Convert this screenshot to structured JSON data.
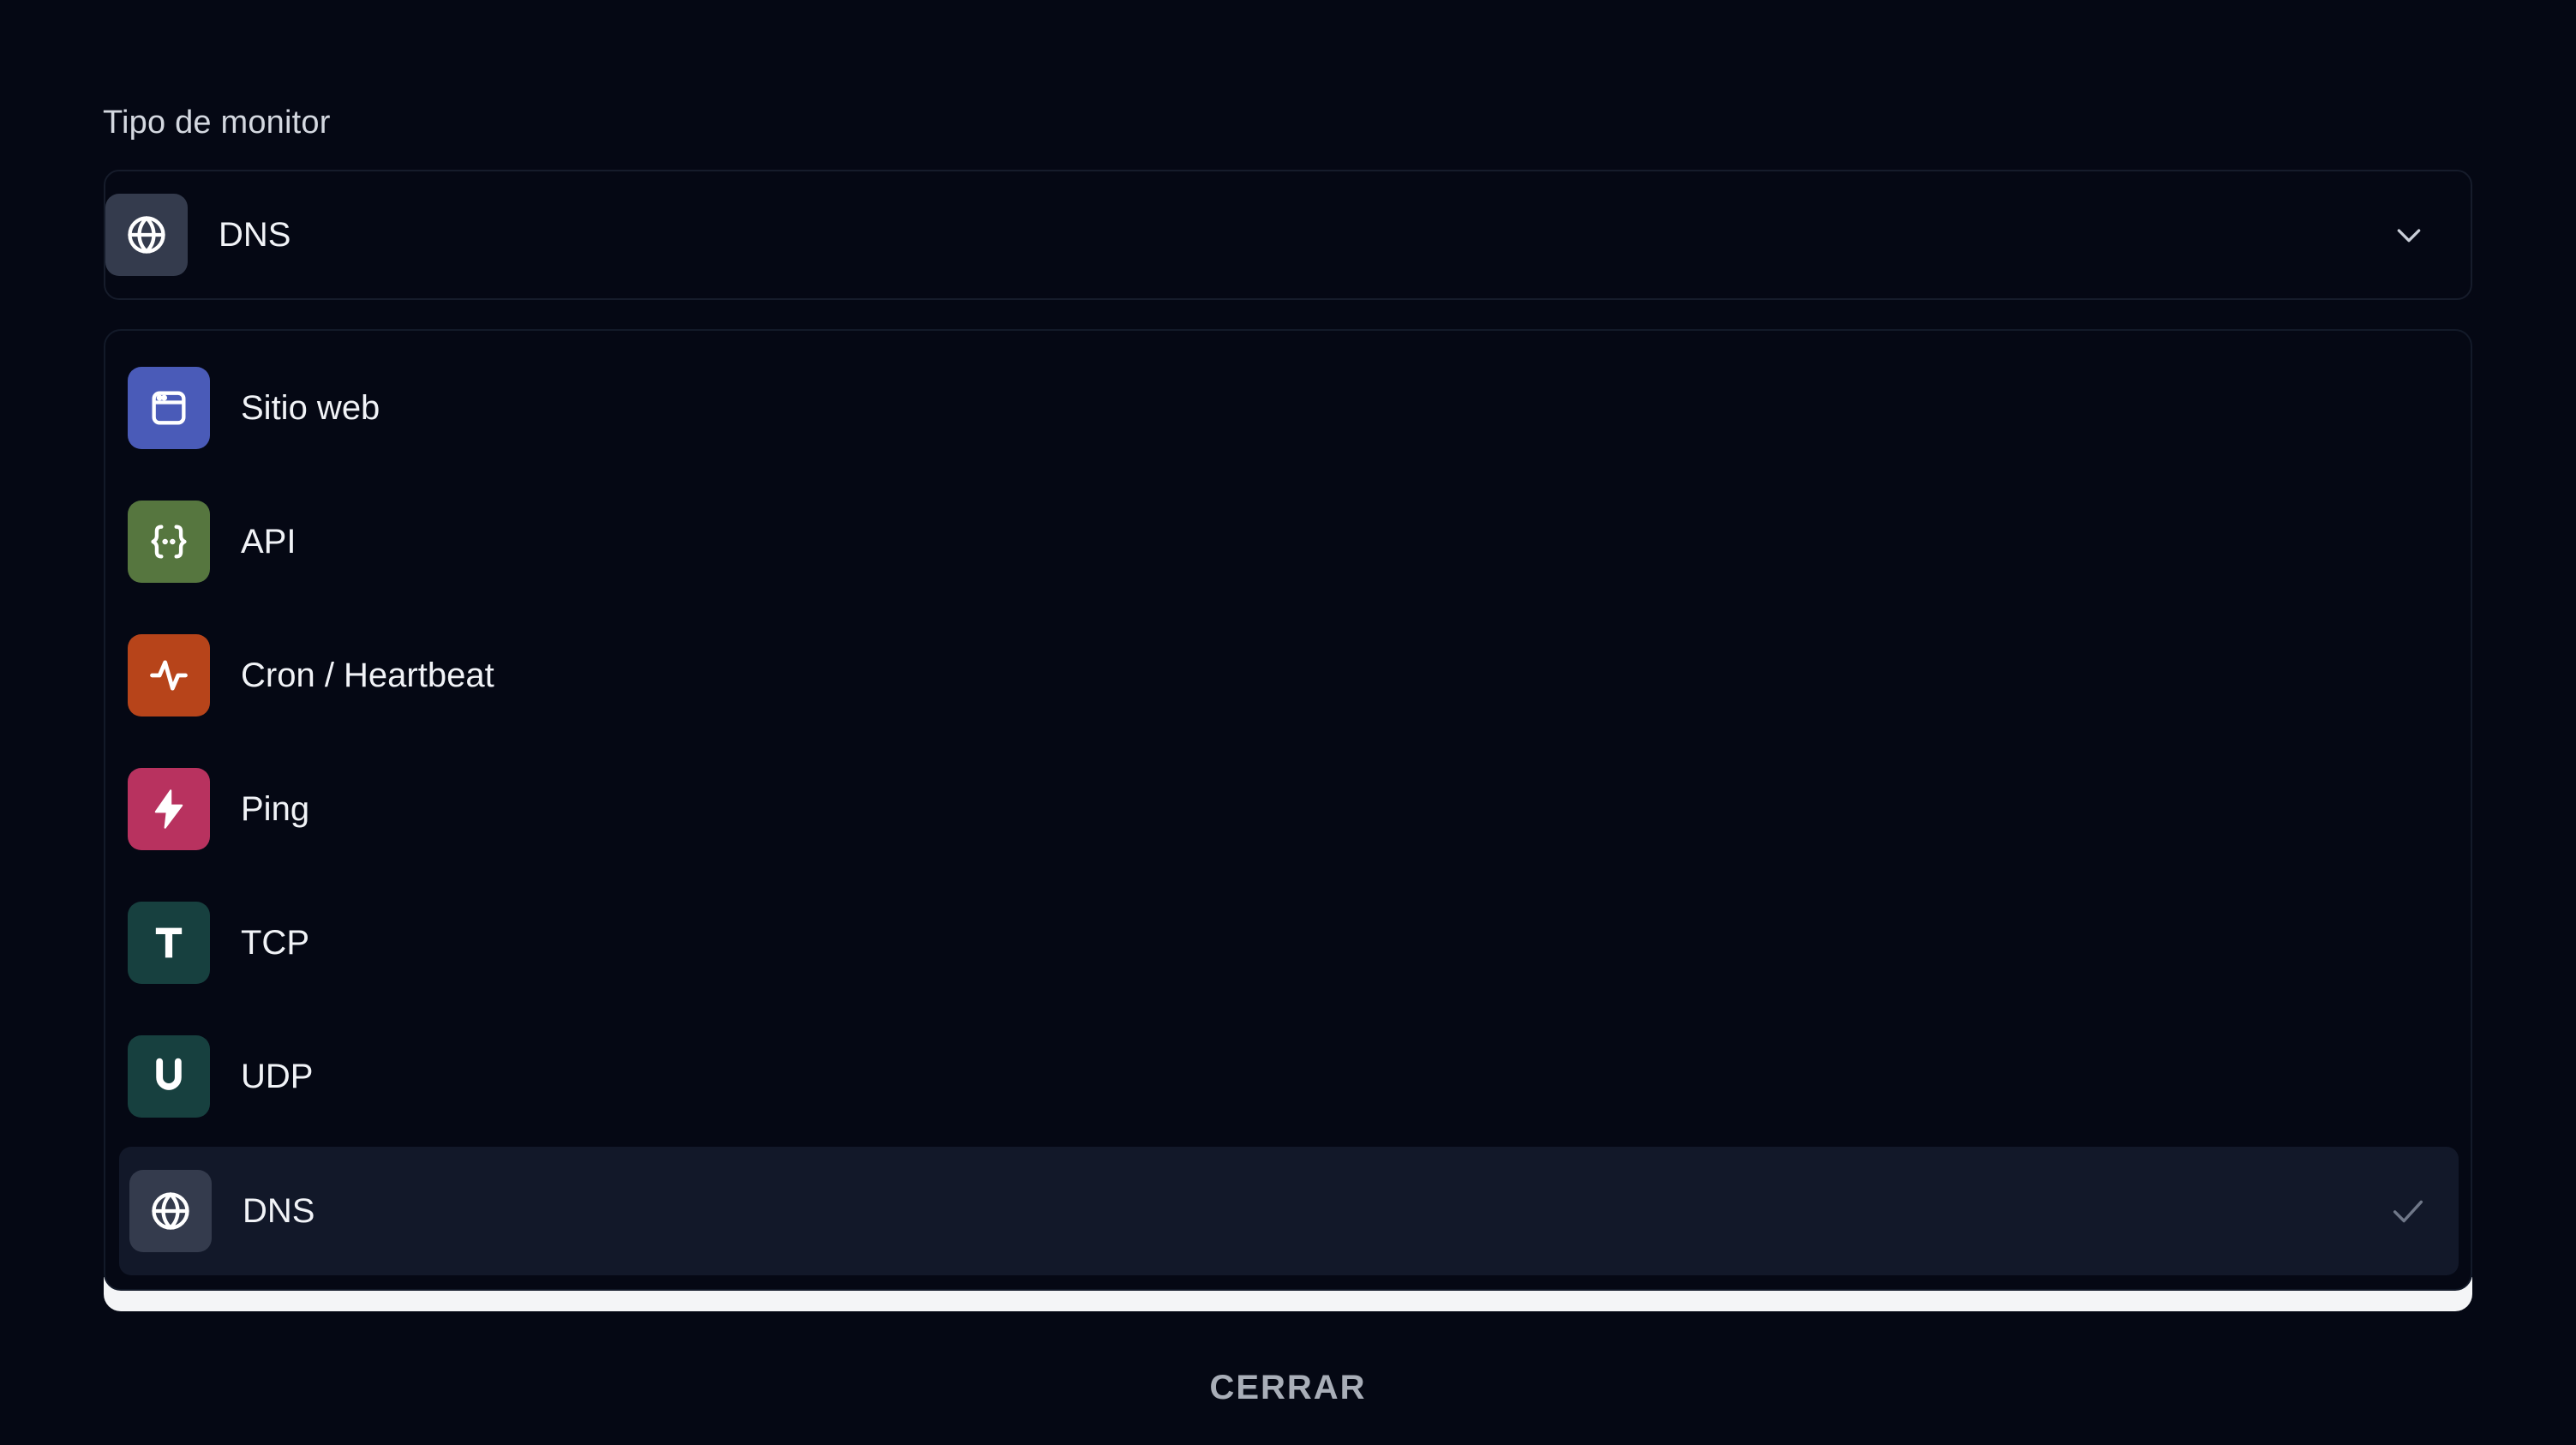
{
  "field": {
    "label": "Tipo de monitor",
    "selected_value": "DNS",
    "selected_icon": "globe-icon"
  },
  "options": [
    {
      "label": "Sitio web",
      "icon": "browser-window-icon",
      "color": "#4a5bb8"
    },
    {
      "label": "API",
      "icon": "curly-braces-icon",
      "color": "#56763f"
    },
    {
      "label": "Cron / Heartbeat",
      "icon": "pulse-icon",
      "color": "#b7441a"
    },
    {
      "label": "Ping",
      "icon": "lightning-icon",
      "color": "#b8325f"
    },
    {
      "label": "TCP",
      "icon": "letter-t-icon",
      "color": "#17403f"
    },
    {
      "label": "UDP",
      "icon": "letter-u-icon",
      "color": "#17403f"
    },
    {
      "label": "DNS",
      "icon": "globe-icon",
      "color": "#343b4d",
      "selected": true
    }
  ],
  "footer": {
    "close_label": "CERRAR"
  }
}
